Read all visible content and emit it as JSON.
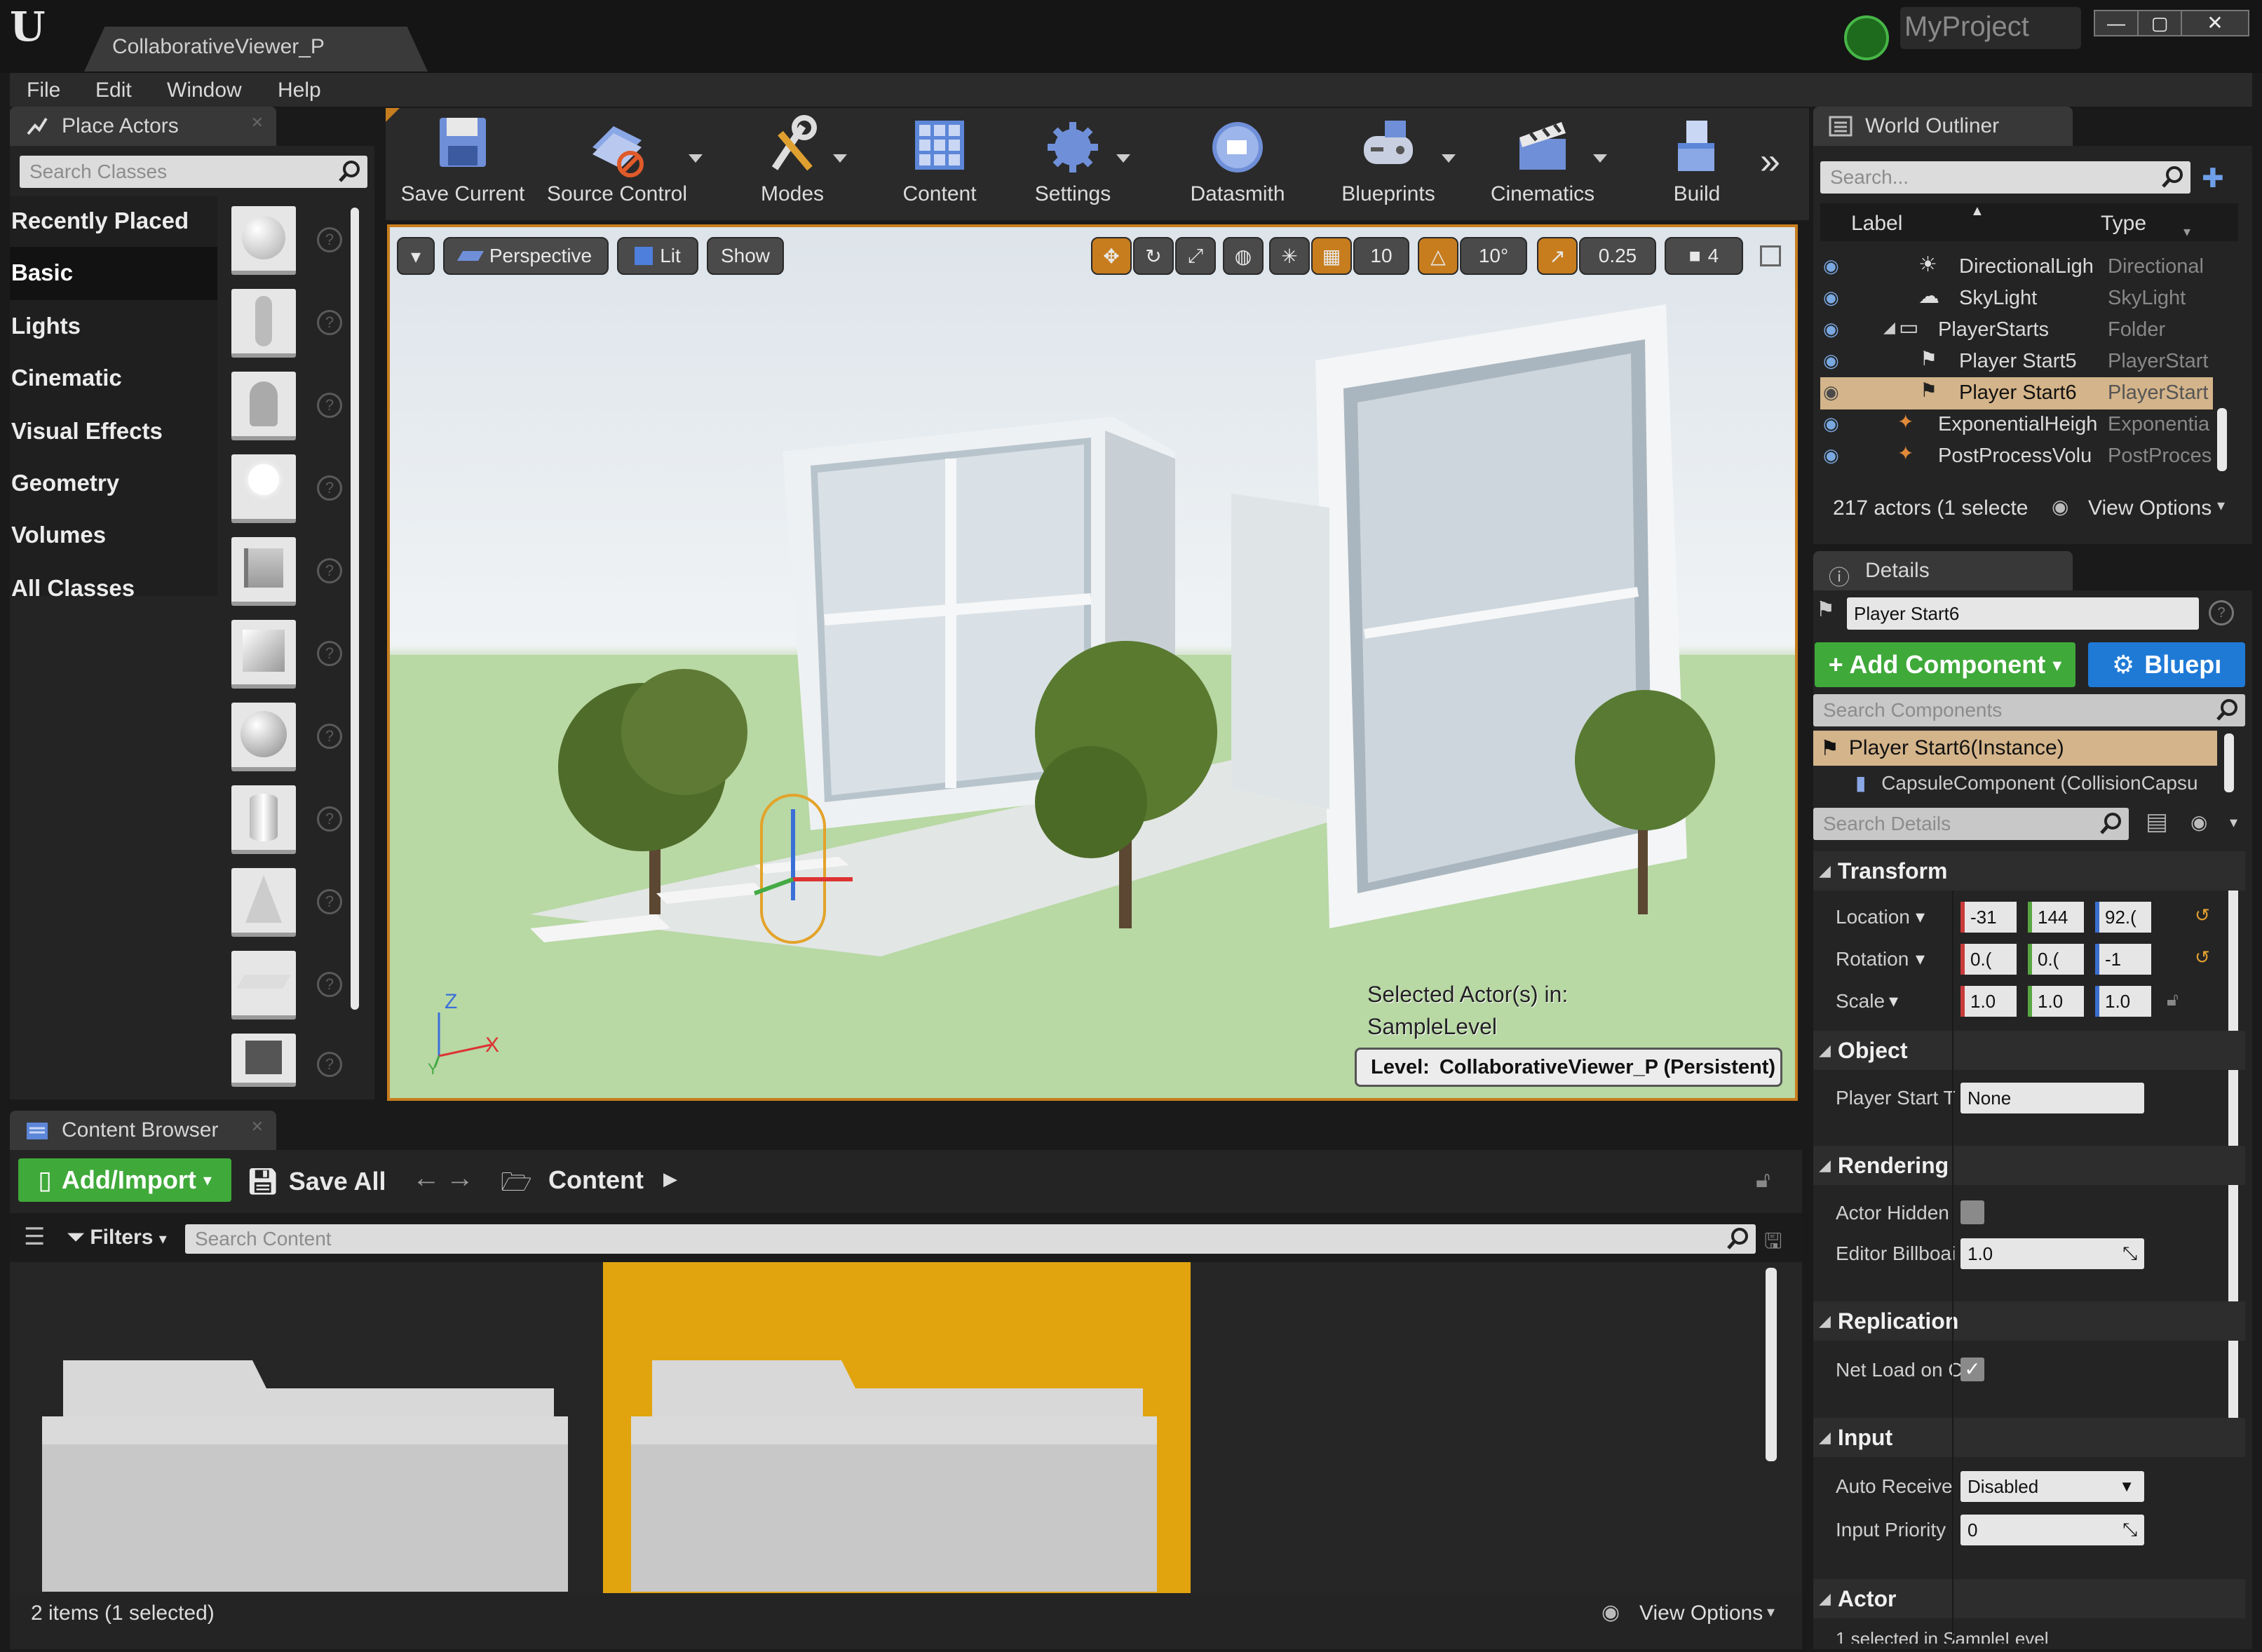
{
  "window": {
    "tab_title": "CollaborativeViewer_P",
    "project_name": "MyProject",
    "min_label": "—",
    "max_label": "▢",
    "close_label": "✕"
  },
  "menu": [
    "File",
    "Edit",
    "Window",
    "Help"
  ],
  "place_actors": {
    "tab_label": "Place Actors",
    "search_placeholder": "Search Classes",
    "categories": [
      "Recently Placed",
      "Basic",
      "Lights",
      "Cinematic",
      "Visual Effects",
      "Geometry",
      "Volumes",
      "All Classes"
    ],
    "selected_category": "Basic"
  },
  "toolbar": {
    "buttons": [
      "Save Current",
      "Source Control",
      "Modes",
      "Content",
      "Settings",
      "Datasmith",
      "Blueprints",
      "Cinematics",
      "Build"
    ]
  },
  "viewport": {
    "perspective_label": "Perspective",
    "lit_label": "Lit",
    "show_label": "Show",
    "grid_snap": "10",
    "rot_snap": "10°",
    "scale_snap": "0.25",
    "camera_speed": "4",
    "selected_actor_text": "Selected Actor(s) in:",
    "selected_level": "SampleLevel",
    "level_prefix": "Level:",
    "level_name": "CollaborativeViewer_P (Persistent)",
    "axis_z": "Z",
    "axis_y": "Y",
    "axis_x": "X"
  },
  "outliner": {
    "tab_label": "World Outliner",
    "search_placeholder": "Search...",
    "col_label": "Label",
    "col_type": "Type",
    "rows": [
      {
        "label": "DirectionalLigh",
        "type": "Directional"
      },
      {
        "label": "SkyLight",
        "type": "SkyLight"
      },
      {
        "label": "PlayerStarts",
        "type": "Folder"
      },
      {
        "label": "Player Start5",
        "type": "PlayerStart"
      },
      {
        "label": "Player Start6",
        "type": "PlayerStart"
      },
      {
        "label": "ExponentialHeigh",
        "type": "Exponentia"
      },
      {
        "label": "PostProcessVolu",
        "type": "PostProces"
      }
    ],
    "status": "217 actors (1 selecte",
    "view_options": "View Options"
  },
  "details": {
    "tab_label": "Details",
    "name_value": "Player Start6",
    "add_component": "+ Add Component",
    "blueprint": "Bluepı",
    "search_components": "Search Components",
    "component_root": "Player Start6(Instance)",
    "component_child": "CapsuleComponent (CollisionCapsu",
    "search_details": "Search Details",
    "sections": {
      "transform": "Transform",
      "object": "Object",
      "rendering": "Rendering",
      "replication": "Replication",
      "input": "Input",
      "actor": "Actor"
    },
    "location_label": "Location",
    "rotation_label": "Rotation",
    "scale_label": "Scale",
    "location": [
      "-31",
      "144",
      "92.("
    ],
    "rotation": [
      "0.(",
      "0.(",
      "-1"
    ],
    "scale": [
      "1.0",
      "1.0",
      "1.0"
    ],
    "player_start_label": "Player Start T",
    "player_start_value": "None",
    "actor_hidden_label": "Actor Hidden",
    "editor_billboard_label": "Editor Billboai",
    "editor_billboard_value": "1.0",
    "net_load_label": "Net Load on C",
    "auto_receive_label": "Auto Receive",
    "auto_receive_value": "Disabled",
    "input_priority_label": "Input Priority",
    "input_priority_value": "0",
    "actor_cut": "1 selected in   SampleLevel"
  },
  "content_browser": {
    "tab_label": "Content Browser",
    "add_import": "Add/Import",
    "save_all": "Save All",
    "path_root": "Content",
    "filters": "Filters",
    "search_placeholder": "Search Content",
    "status": "2 items (1 selected)",
    "view_options": "View Options"
  },
  "colors": {
    "accent_orange": "#c77d1e",
    "selection_tan": "#d4b48a",
    "green_button": "#3fa93a",
    "blue_button": "#1f7ad6",
    "folder_selected_bg": "#e1a40f"
  }
}
